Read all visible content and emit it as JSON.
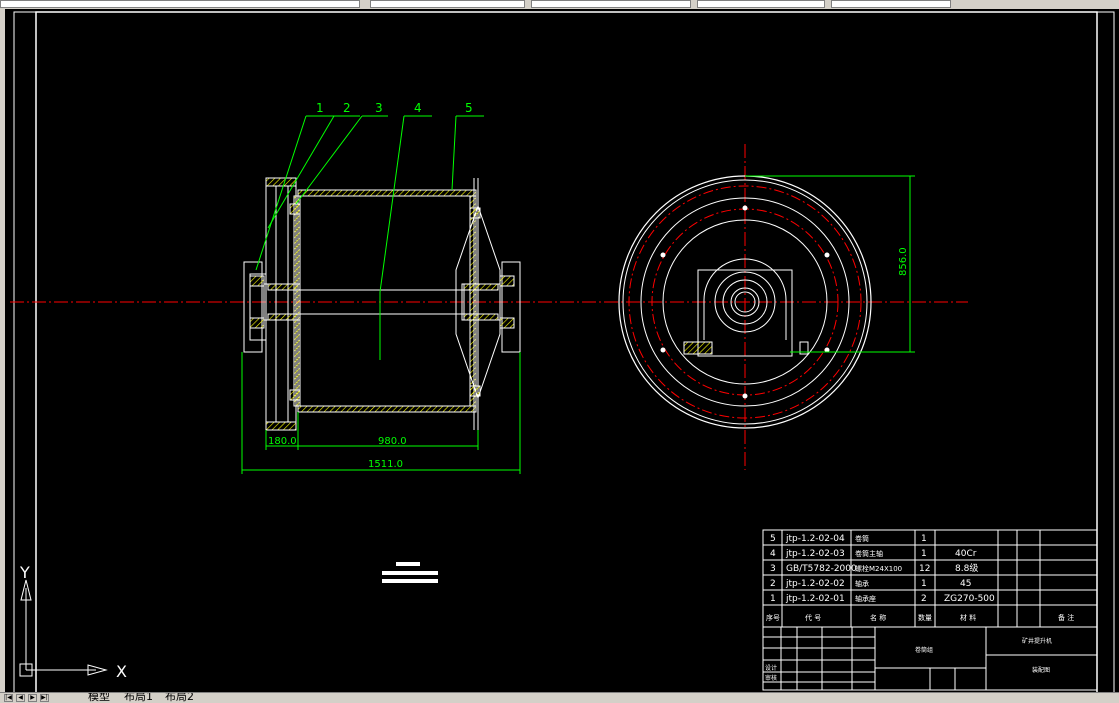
{
  "tabs": [
    "模型",
    "布局1",
    "布局2"
  ],
  "balloons": [
    "1",
    "2",
    "3",
    "4",
    "5"
  ],
  "dimensions": {
    "d180": "180.0",
    "d980": "980.0",
    "d1511": "1511.0",
    "d856": "856.0"
  },
  "ucs": {
    "x_label": "X",
    "y_label": "Y"
  },
  "bom": [
    {
      "no": "5",
      "code": "jtp-1.2-02-04",
      "name": "卷筒",
      "qty": "1",
      "material": ""
    },
    {
      "no": "4",
      "code": "jtp-1.2-02-03",
      "name": "卷筒主轴",
      "qty": "1",
      "material": "40Cr"
    },
    {
      "no": "3",
      "code": "GB/T5782-2000",
      "name": "螺栓M24X100",
      "qty": "12",
      "material": "8.8级"
    },
    {
      "no": "2",
      "code": "jtp-1.2-02-02",
      "name": "轴承",
      "qty": "1",
      "material": "45"
    },
    {
      "no": "1",
      "code": "jtp-1.2-02-01",
      "name": "轴承座",
      "qty": "2",
      "material": "ZG270-500"
    }
  ],
  "bom_header": {
    "no": "序号",
    "code": "代 号",
    "name": "名 称",
    "qty": "数量",
    "material": "材 料",
    "remark": "备 注"
  },
  "title_block": {
    "design": "设计",
    "check": "审核",
    "drawing_name": "卷筒组",
    "company": "矿井提升机",
    "drawing_code": "装配图"
  },
  "colors": {
    "yellow": "#ffff00",
    "green": "#00ff00",
    "red": "#ff0000",
    "white": "#ffffff",
    "cyan": "#00ffff"
  }
}
